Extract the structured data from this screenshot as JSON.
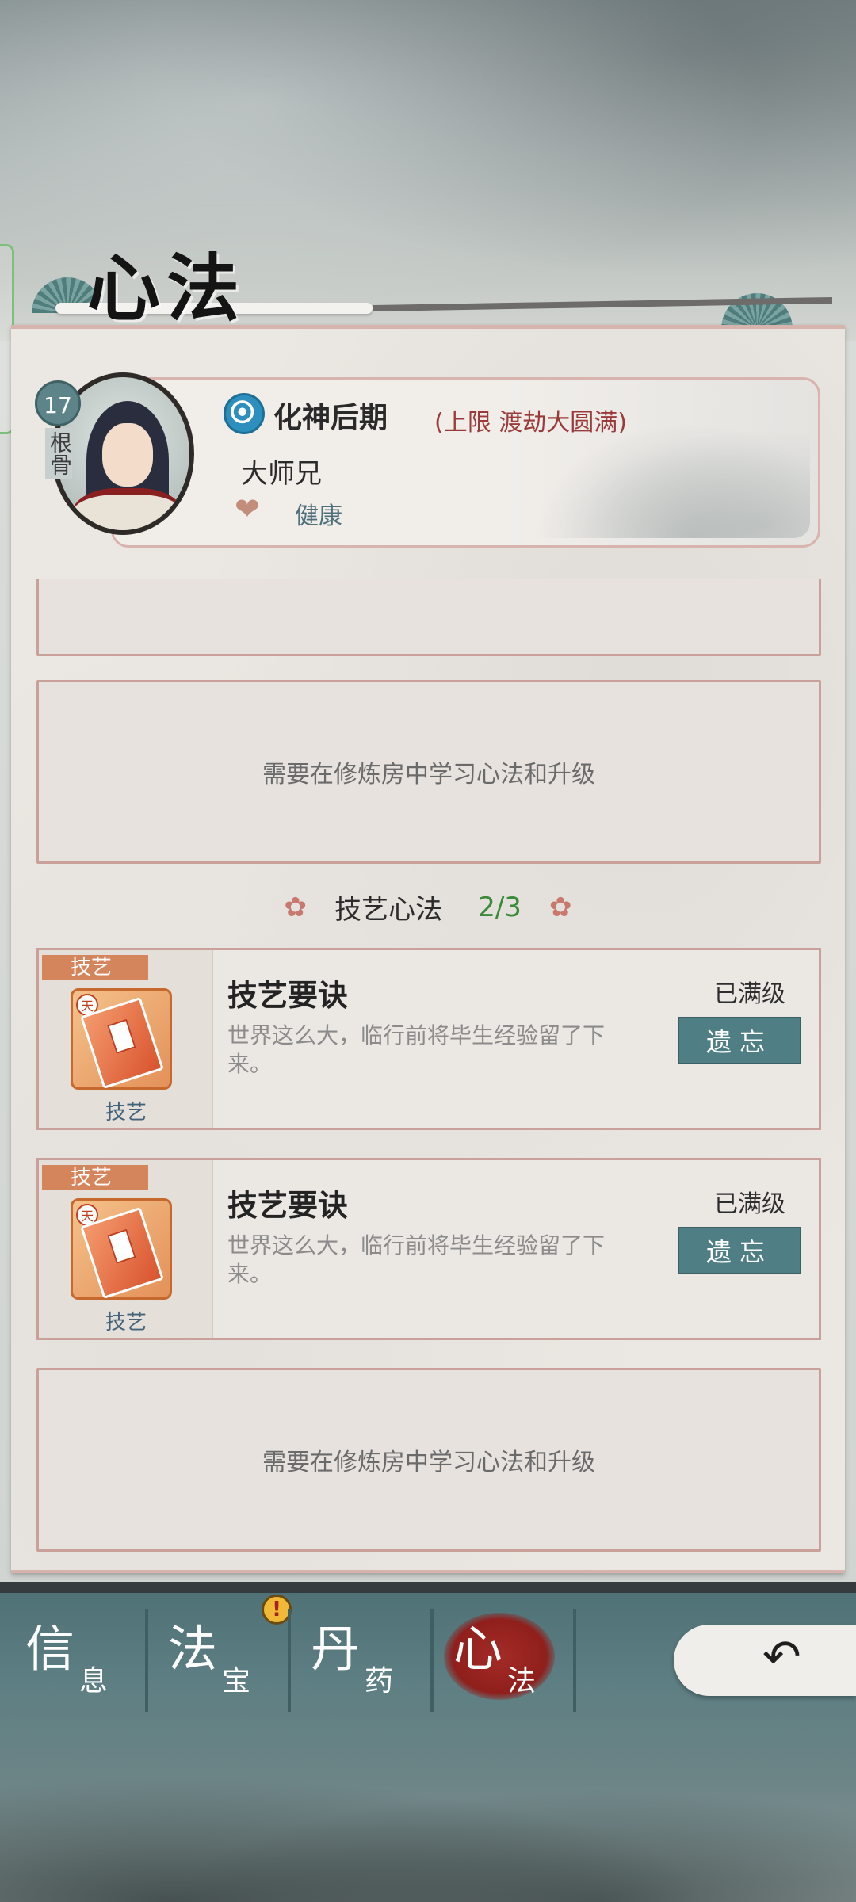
{
  "header": {
    "title": "心法"
  },
  "character": {
    "level": "17",
    "level_label": "根骨",
    "realm": "化神后期",
    "realm_limit": "(上限 渡劫大圆满)",
    "name": "大师兄",
    "health": "健康"
  },
  "slots": {
    "empty_text_1": "需要在修炼房中学习心法和升级",
    "empty_text_2": "需要在修炼房中学习心法和升级"
  },
  "section": {
    "title": "技艺心法",
    "count": "2/3"
  },
  "skills": [
    {
      "tag": "技艺",
      "seal": "天",
      "caption": "技艺",
      "name": "技艺要诀",
      "desc": "世界这么大，临行前将毕生经验留了下来。",
      "status": "已满级",
      "button": "遗忘"
    },
    {
      "tag": "技艺",
      "seal": "天",
      "caption": "技艺",
      "name": "技艺要诀",
      "desc": "世界这么大，临行前将毕生经验留了下来。",
      "status": "已满级",
      "button": "遗忘"
    }
  ],
  "nav": {
    "items": [
      {
        "big": "信",
        "small": "息"
      },
      {
        "big": "法",
        "small": "宝"
      },
      {
        "big": "丹",
        "small": "药"
      },
      {
        "big": "心",
        "small": "法"
      }
    ],
    "alert": "!",
    "active_index": 3
  },
  "colors": {
    "accent": "#4f7f84",
    "border": "#c9a09a",
    "count_green": "#3a8a3a",
    "limit_red": "#9b3a3a"
  }
}
